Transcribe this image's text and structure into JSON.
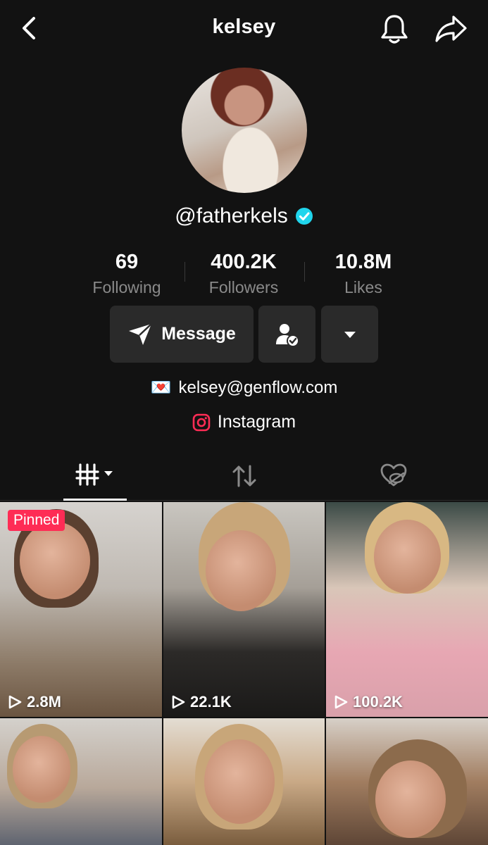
{
  "header": {
    "title": "kelsey",
    "back_icon": "chevron-left-icon",
    "bell_icon": "bell-icon",
    "share_icon": "share-arrow-icon"
  },
  "profile": {
    "handle": "@fatherkels",
    "verified": true,
    "verified_color": "#20d5ec"
  },
  "stats": [
    {
      "value": "69",
      "label": "Following"
    },
    {
      "value": "400.2K",
      "label": "Followers"
    },
    {
      "value": "10.8M",
      "label": "Likes"
    }
  ],
  "actions": {
    "message_label": "Message",
    "message_icon": "send-arrow-icon",
    "friend_icon": "user-check-icon",
    "more_icon": "caret-down-icon"
  },
  "bio": {
    "email_emoji": "💌",
    "email": "kelsey@genflow.com",
    "instagram_label": "Instagram",
    "instagram_icon": "instagram-icon",
    "instagram_color": "#fe2c55"
  },
  "tabs": [
    {
      "icon": "videos-grid-icon",
      "active": true
    },
    {
      "icon": "repost-icon",
      "active": false
    },
    {
      "icon": "liked-hidden-icon",
      "active": false
    }
  ],
  "videos": [
    {
      "views": "2.8M",
      "pinned": true,
      "pinned_label": "Pinned"
    },
    {
      "views": "22.1K",
      "pinned": false
    },
    {
      "views": "100.2K",
      "pinned": false
    },
    {
      "views": "",
      "pinned": false
    },
    {
      "views": "",
      "pinned": false
    },
    {
      "views": "",
      "pinned": false
    }
  ]
}
